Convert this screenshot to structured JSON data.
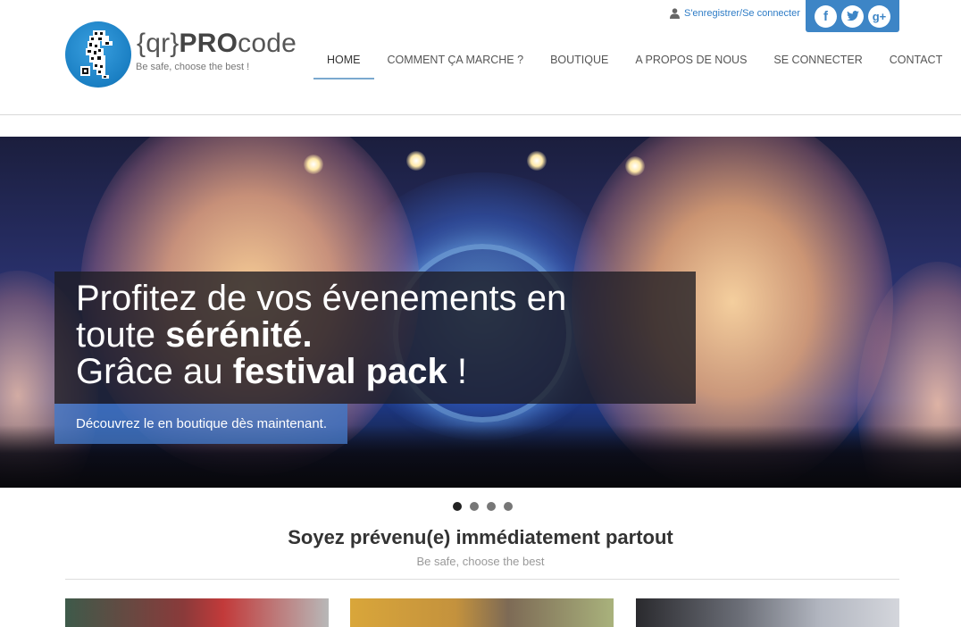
{
  "brand": {
    "title_prefix": "{qr}",
    "title_bold": "PRO",
    "title_suffix": "code",
    "tagline": "Be safe, choose the best !"
  },
  "account": {
    "link_label": "S'enregistrer/Se connecter",
    "icon": "user-icon"
  },
  "social": [
    {
      "name": "facebook",
      "glyph": "f"
    },
    {
      "name": "twitter",
      "glyph": "t"
    },
    {
      "name": "google-plus",
      "glyph": "g+"
    }
  ],
  "nav": {
    "items": [
      {
        "label": "HOME",
        "active": true
      },
      {
        "label": "COMMENT ÇA MARCHE ?",
        "active": false
      },
      {
        "label": "BOUTIQUE",
        "active": false
      },
      {
        "label": "A PROPOS DE NOUS",
        "active": false
      },
      {
        "label": "SE CONNECTER",
        "active": false
      },
      {
        "label": "CONTACT",
        "active": false
      }
    ]
  },
  "hero": {
    "line1": "Profitez de vos évenements en",
    "line2_plain": "toute ",
    "line2_bold": "sérénité.",
    "line3_plain": "Grâce au ",
    "line3_bold": "festival pack",
    "line3_end": " !",
    "cta": "Découvrez le en boutique dès maintenant.",
    "slides": 4,
    "active_slide": 1
  },
  "section": {
    "title": "Soyez prévenu(e) immédiatement partout",
    "subtitle": "Be safe, choose the best"
  },
  "colors": {
    "accent": "#3d85c6",
    "link": "#2e7cc6"
  }
}
